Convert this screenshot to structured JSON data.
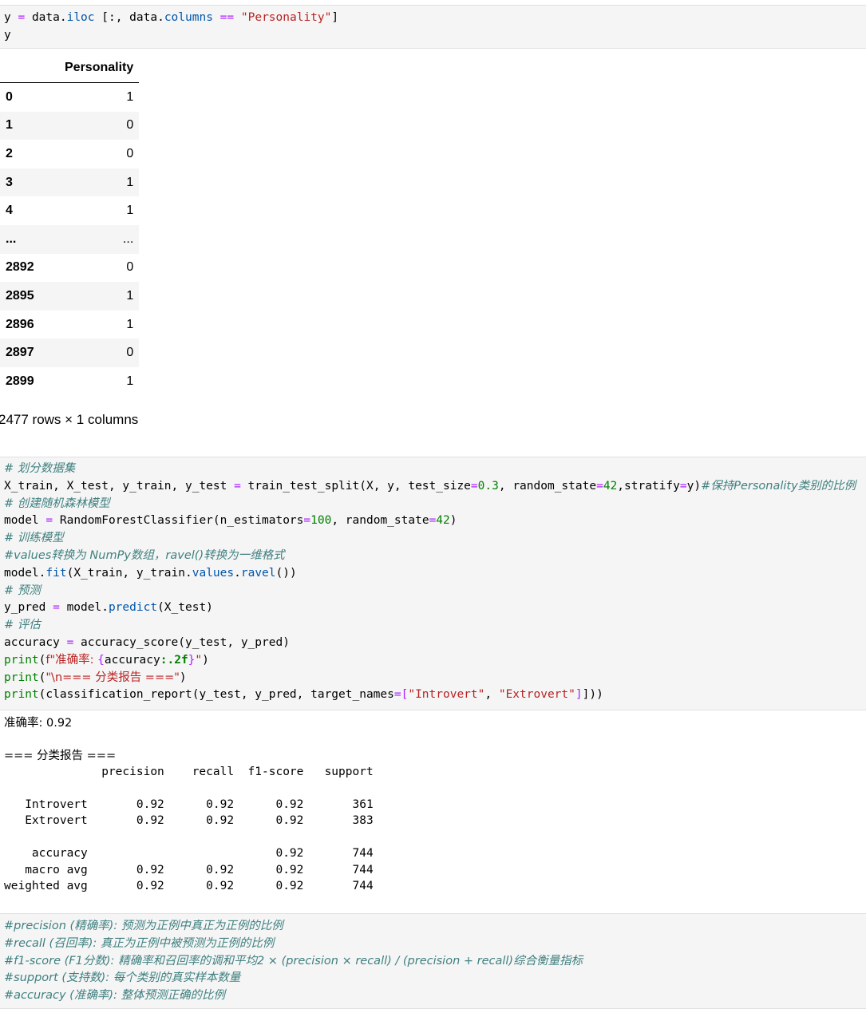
{
  "cell1": {
    "line1": {
      "v": "y",
      "eq": "=",
      "obj": "data.",
      "attr1": "iloc",
      "br": " [:, data.",
      "attr2": "columns",
      "op": "==",
      "str": "\"Personality\"",
      "close": "]"
    },
    "line2": "y"
  },
  "dataframe": {
    "column": "Personality",
    "rows": [
      {
        "index": "0",
        "value": "1"
      },
      {
        "index": "1",
        "value": "0"
      },
      {
        "index": "2",
        "value": "0"
      },
      {
        "index": "3",
        "value": "1"
      },
      {
        "index": "4",
        "value": "1"
      },
      {
        "index": "...",
        "value": "..."
      },
      {
        "index": "2892",
        "value": "0"
      },
      {
        "index": "2895",
        "value": "1"
      },
      {
        "index": "2896",
        "value": "1"
      },
      {
        "index": "2897",
        "value": "0"
      },
      {
        "index": "2899",
        "value": "1"
      }
    ],
    "shape": "2477 rows × 1 columns"
  },
  "cell2": {
    "c1": "# 划分数据集",
    "l2a": "X_train, X_test, y_train, y_test ",
    "l2eq": "=",
    "l2b": " train_test_split(X, y, test_size",
    "l2eq2": "=",
    "l2n1": "0.3",
    "l2c": ", random_state",
    "l2eq3": "=",
    "l2n2": "42",
    "l2d": ",stratify",
    "l2eq4": "=",
    "l2e": "y)",
    "l2cm": "#保持Personality类别的比例",
    "c3": "# 创建随机森林模型",
    "l4a": "model ",
    "l4eq": "=",
    "l4b": " RandomForestClassifier(n_estimators",
    "l4eq2": "=",
    "l4n1": "100",
    "l4c": ", random_state",
    "l4eq3": "=",
    "l4n2": "42",
    "l4d": ")",
    "c5": "# 训练模型",
    "c6": "#values转换为 NumPy数组，ravel()转换为一维格式",
    "l7a": "model.",
    "l7fit": "fit",
    "l7b": "(X_train, y_train.",
    "l7vals": "values",
    "l7c": ".",
    "l7ravel": "ravel",
    "l7d": "())",
    "c8": "# 预测",
    "l9a": "y_pred ",
    "l9eq": "=",
    "l9b": " model.",
    "l9pred": "predict",
    "l9c": "(X_test)",
    "c10": "# 评估",
    "l11a": "accuracy ",
    "l11eq": "=",
    "l11b": " accuracy_score(y_test, y_pred)",
    "l12print": "print",
    "l12a": "(",
    "l12s1": "f\"准确率: ",
    "l12br": "{",
    "l12acc": "accuracy",
    "l12fmt": ":.2f",
    "l12br2": "}",
    "l12s2": "\"",
    "l12b": ")",
    "l13print": "print",
    "l13a": "(",
    "l13s": "\"\\n=== 分类报告 ===\"",
    "l13b": ")",
    "l14print": "print",
    "l14a": "(classification_report(y_test, y_pred, target_names",
    "l14eq": "=",
    "l14b": "[",
    "l14s1": "\"Introvert\"",
    "l14c": ", ",
    "l14s2": "\"Extrovert\"",
    "l14d": "]))"
  },
  "output2": {
    "lines": [
      "准确率: 0.92",
      "",
      "=== 分类报告 ===",
      "              precision    recall  f1-score   support",
      "",
      "   Introvert       0.92      0.92      0.92       361",
      "   Extrovert       0.92      0.92      0.92       383",
      "",
      "    accuracy                           0.92       744",
      "   macro avg       0.92      0.92      0.92       744",
      "weighted avg       0.92      0.92      0.92       744"
    ]
  },
  "cell3": {
    "lines": [
      "#precision (精确率): 预测为正例中真正为正例的比例",
      "#recall (召回率): 真正为正例中被预测为正例的比例",
      "#f1-score (F1分数): 精确率和召回率的调和平均2 × (precision × recall) / (precision + recall)综合衡量指标",
      "#support (支持数): 每个类别的真实样本数量",
      "#accuracy (准确率): 整体预测正确的比例"
    ]
  }
}
